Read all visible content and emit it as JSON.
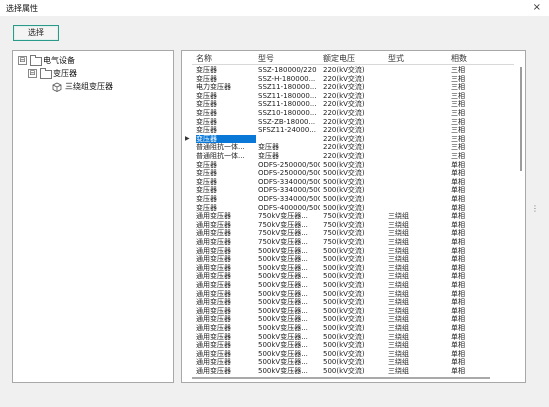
{
  "window": {
    "title": "选择属性",
    "close_icon": "×"
  },
  "toolbar": {
    "select_label": "选择"
  },
  "tree": {
    "root": {
      "label": "电气设备",
      "expander": "⊟"
    },
    "child": {
      "label": "变压器",
      "expander": "⊟"
    },
    "leaf": {
      "label": "三绕组变压器"
    }
  },
  "grid": {
    "columns": [
      "名称",
      "型号",
      "额定电压",
      "型式",
      "相数"
    ],
    "selected_row_index": 8,
    "rows": [
      [
        "变压器",
        "SSZ-180000/220",
        "220(kV交流)",
        "",
        "三相"
      ],
      [
        "变压器",
        "SSZ-H-180000...",
        "220(kV交流)",
        "",
        "三相"
      ],
      [
        "电力变压器",
        "SSZ11-180000...",
        "220(kV交流)",
        "",
        "三相"
      ],
      [
        "变压器",
        "SSZ11-180000...",
        "220(kV交流)",
        "",
        "三相"
      ],
      [
        "变压器",
        "SSZ11-180000...",
        "220(kV交流)",
        "",
        "三相"
      ],
      [
        "变压器",
        "SSZ10-180000...",
        "220(kV交流)",
        "",
        "三相"
      ],
      [
        "变压器",
        "SSZ-ZB-18000...",
        "220(kV交流)",
        "",
        "三相"
      ],
      [
        "变压器",
        "SFSZ11-24000...",
        "220(kV交流)",
        "",
        "三相"
      ],
      [
        "变压器",
        "",
        "220(kV交流)",
        "",
        "三相"
      ],
      [
        "普通阻抗一体...",
        "变压器",
        "220(kV交流)",
        "",
        "三相"
      ],
      [
        "普通阻抗一体...",
        "变压器",
        "220(kV交流)",
        "",
        "三相"
      ],
      [
        "变压器",
        "ODFS-250000/500",
        "500(kV交流)",
        "",
        "单相"
      ],
      [
        "变压器",
        "ODFS-250000/500",
        "500(kV交流)",
        "",
        "单相"
      ],
      [
        "变压器",
        "ODFS-334000/500",
        "500(kV交流)",
        "",
        "单相"
      ],
      [
        "变压器",
        "ODFS-334000/500",
        "500(kV交流)",
        "",
        "单相"
      ],
      [
        "变压器",
        "ODFS-334000/500",
        "500(kV交流)",
        "",
        "单相"
      ],
      [
        "变压器",
        "ODFS-400000/500",
        "500(kV交流)",
        "",
        "单相"
      ],
      [
        "通用变压器",
        "750kV变压器...",
        "750(kV交流)",
        "三绕组",
        "单相"
      ],
      [
        "通用变压器",
        "750kV变压器...",
        "750(kV交流)",
        "三绕组",
        "单相"
      ],
      [
        "通用变压器",
        "750kV变压器...",
        "750(kV交流)",
        "三绕组",
        "单相"
      ],
      [
        "通用变压器",
        "750kV变压器...",
        "750(kV交流)",
        "三绕组",
        "单相"
      ],
      [
        "通用变压器",
        "500kV变压器...",
        "500(kV交流)",
        "三绕组",
        "单相"
      ],
      [
        "通用变压器",
        "500kV变压器...",
        "500(kV交流)",
        "三绕组",
        "单相"
      ],
      [
        "通用变压器",
        "500kV变压器...",
        "500(kV交流)",
        "三绕组",
        "单相"
      ],
      [
        "通用变压器",
        "500kV变压器...",
        "500(kV交流)",
        "三绕组",
        "单相"
      ],
      [
        "通用变压器",
        "500kV变压器...",
        "500(kV交流)",
        "三绕组",
        "单相"
      ],
      [
        "通用变压器",
        "500kV变压器...",
        "500(kV交流)",
        "三绕组",
        "单相"
      ],
      [
        "通用变压器",
        "500kV变压器...",
        "500(kV交流)",
        "三绕组",
        "单相"
      ],
      [
        "通用变压器",
        "500kV变压器...",
        "500(kV交流)",
        "三绕组",
        "单相"
      ],
      [
        "通用变压器",
        "500kV变压器...",
        "500(kV交流)",
        "三绕组",
        "单相"
      ],
      [
        "通用变压器",
        "500kV变压器...",
        "500(kV交流)",
        "三绕组",
        "单相"
      ],
      [
        "通用变压器",
        "500kV变压器...",
        "500(kV交流)",
        "三绕组",
        "单相"
      ],
      [
        "通用变压器",
        "500kV变压器...",
        "500(kV交流)",
        "三绕组",
        "单相"
      ],
      [
        "通用变压器",
        "500kV变压器...",
        "500(kV交流)",
        "三绕组",
        "单相"
      ],
      [
        "通用变压器",
        "500kV变压器...",
        "500(kV交流)",
        "三绕组",
        "单相"
      ],
      [
        "通用变压器",
        "500kV变压器...",
        "500(kV交流)",
        "三绕组",
        "单相"
      ]
    ]
  },
  "splitter_icon": "⋮",
  "colors": {
    "selection": "#0a78d7",
    "button_border": "#2a9a8a"
  }
}
